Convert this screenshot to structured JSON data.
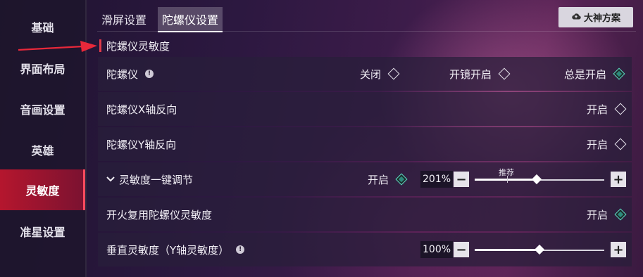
{
  "sidebar": {
    "items": [
      "基础",
      "界面布局",
      "音画设置",
      "英雄",
      "灵敏度",
      "准星设置"
    ],
    "active_index": 4
  },
  "tabs": [
    "滑屏设置",
    "陀螺仪设置"
  ],
  "active_tab_index": 1,
  "plan_button": {
    "label": "大神方案",
    "icon": "cloud-icon"
  },
  "section": {
    "title": "陀螺仪灵敏度"
  },
  "rows": {
    "gyro": {
      "label": "陀螺仪",
      "options": [
        "关闭",
        "开镜开启",
        "总是开启"
      ],
      "selected_index": 2
    },
    "x_invert": {
      "label": "陀螺仪X轴反向",
      "option": "开启",
      "checked": false
    },
    "y_invert": {
      "label": "陀螺仪Y轴反向",
      "option": "开启",
      "checked": false
    },
    "one_key": {
      "label": "灵敏度一键调节",
      "option": "开启",
      "checked": true,
      "percent": "201%",
      "recommend_label": "推荐",
      "slider_value": 0.48,
      "recommend_value": 0.25
    },
    "fire_reuse": {
      "label": "开火复用陀螺仪灵敏度",
      "option": "开启",
      "checked": true
    },
    "vertical": {
      "label": "垂直灵敏度（Y轴灵敏度）",
      "percent": "100%",
      "slider_value": 0.5
    }
  },
  "colors": {
    "accent_red": "#b5162e",
    "check_teal": "#5fd4bd"
  }
}
